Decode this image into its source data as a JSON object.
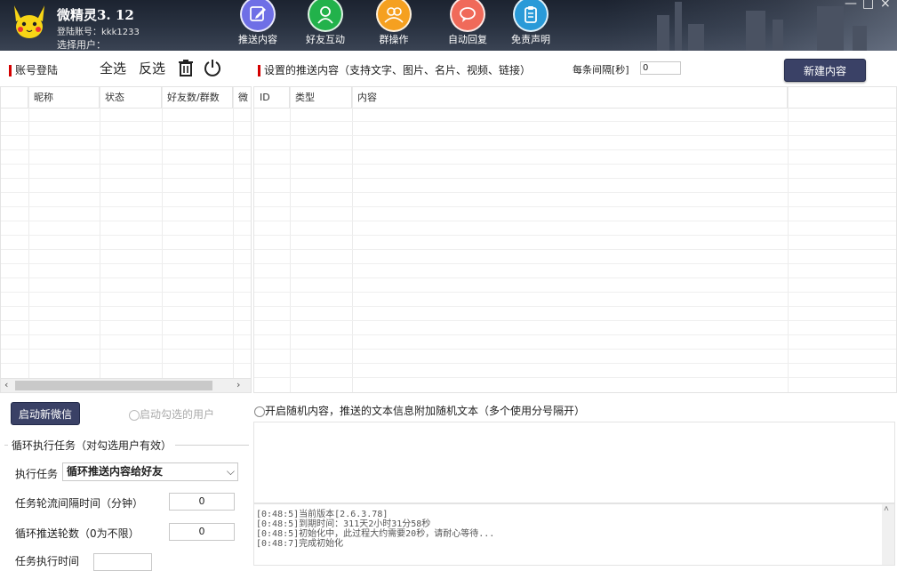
{
  "header": {
    "app_title": "微精灵3. 12",
    "login_label": "登陆账号：kkk1233",
    "select_user_label": "选择用户："
  },
  "nav": [
    {
      "label": "推送内容",
      "icon": "edit-icon",
      "color": "#6f6fe6"
    },
    {
      "label": "好友互动",
      "icon": "user-icon",
      "color": "#22b24b"
    },
    {
      "label": "群操作",
      "icon": "group-icon",
      "color": "#f5a020"
    },
    {
      "label": "自动回复",
      "icon": "chat-icon",
      "color": "#f06a5a"
    },
    {
      "label": "免责声明",
      "icon": "clipboard-icon",
      "color": "#2a9ad8"
    }
  ],
  "window_controls": {
    "minimize": "—",
    "restore": "□",
    "close": "×"
  },
  "accounts": {
    "title": "账号登陆",
    "select_all": "全选",
    "invert": "反选",
    "columns": [
      "昵称",
      "状态",
      "好友数/群数",
      "微"
    ]
  },
  "push": {
    "title": "设置的推送内容（支持文字、图片、名片、视频、链接）",
    "interval_label": "每条间隔[秒]",
    "interval_value": "0",
    "new_button": "新建内容",
    "columns": [
      "ID",
      "类型",
      "内容"
    ]
  },
  "launch": {
    "start_button": "启动新微信",
    "start_checked_label": "启动勾选的用户"
  },
  "loop": {
    "legend": "循环执行任务（对勾选用户有效）",
    "task_label": "执行任务",
    "task_value": "循环推送内容给好友",
    "interval_label": "任务轮流间隔时间（分钟）",
    "interval_value": "0",
    "rounds_label": "循环推送轮数（0为不限）",
    "rounds_value": "0",
    "exec_time_label": "任务执行时间"
  },
  "random": {
    "label": "开启随机内容，推送的文本信息附加随机文本（多个使用分号隔开）"
  },
  "log": [
    "[0:48:5]当前版本[2.6.3.78]",
    "[0:48:5]到期时间：311天2小时31分58秒",
    "[0:48:5]初始化中，此过程大约需要20秒，请耐心等待...",
    "[0:48:7]完成初始化"
  ]
}
